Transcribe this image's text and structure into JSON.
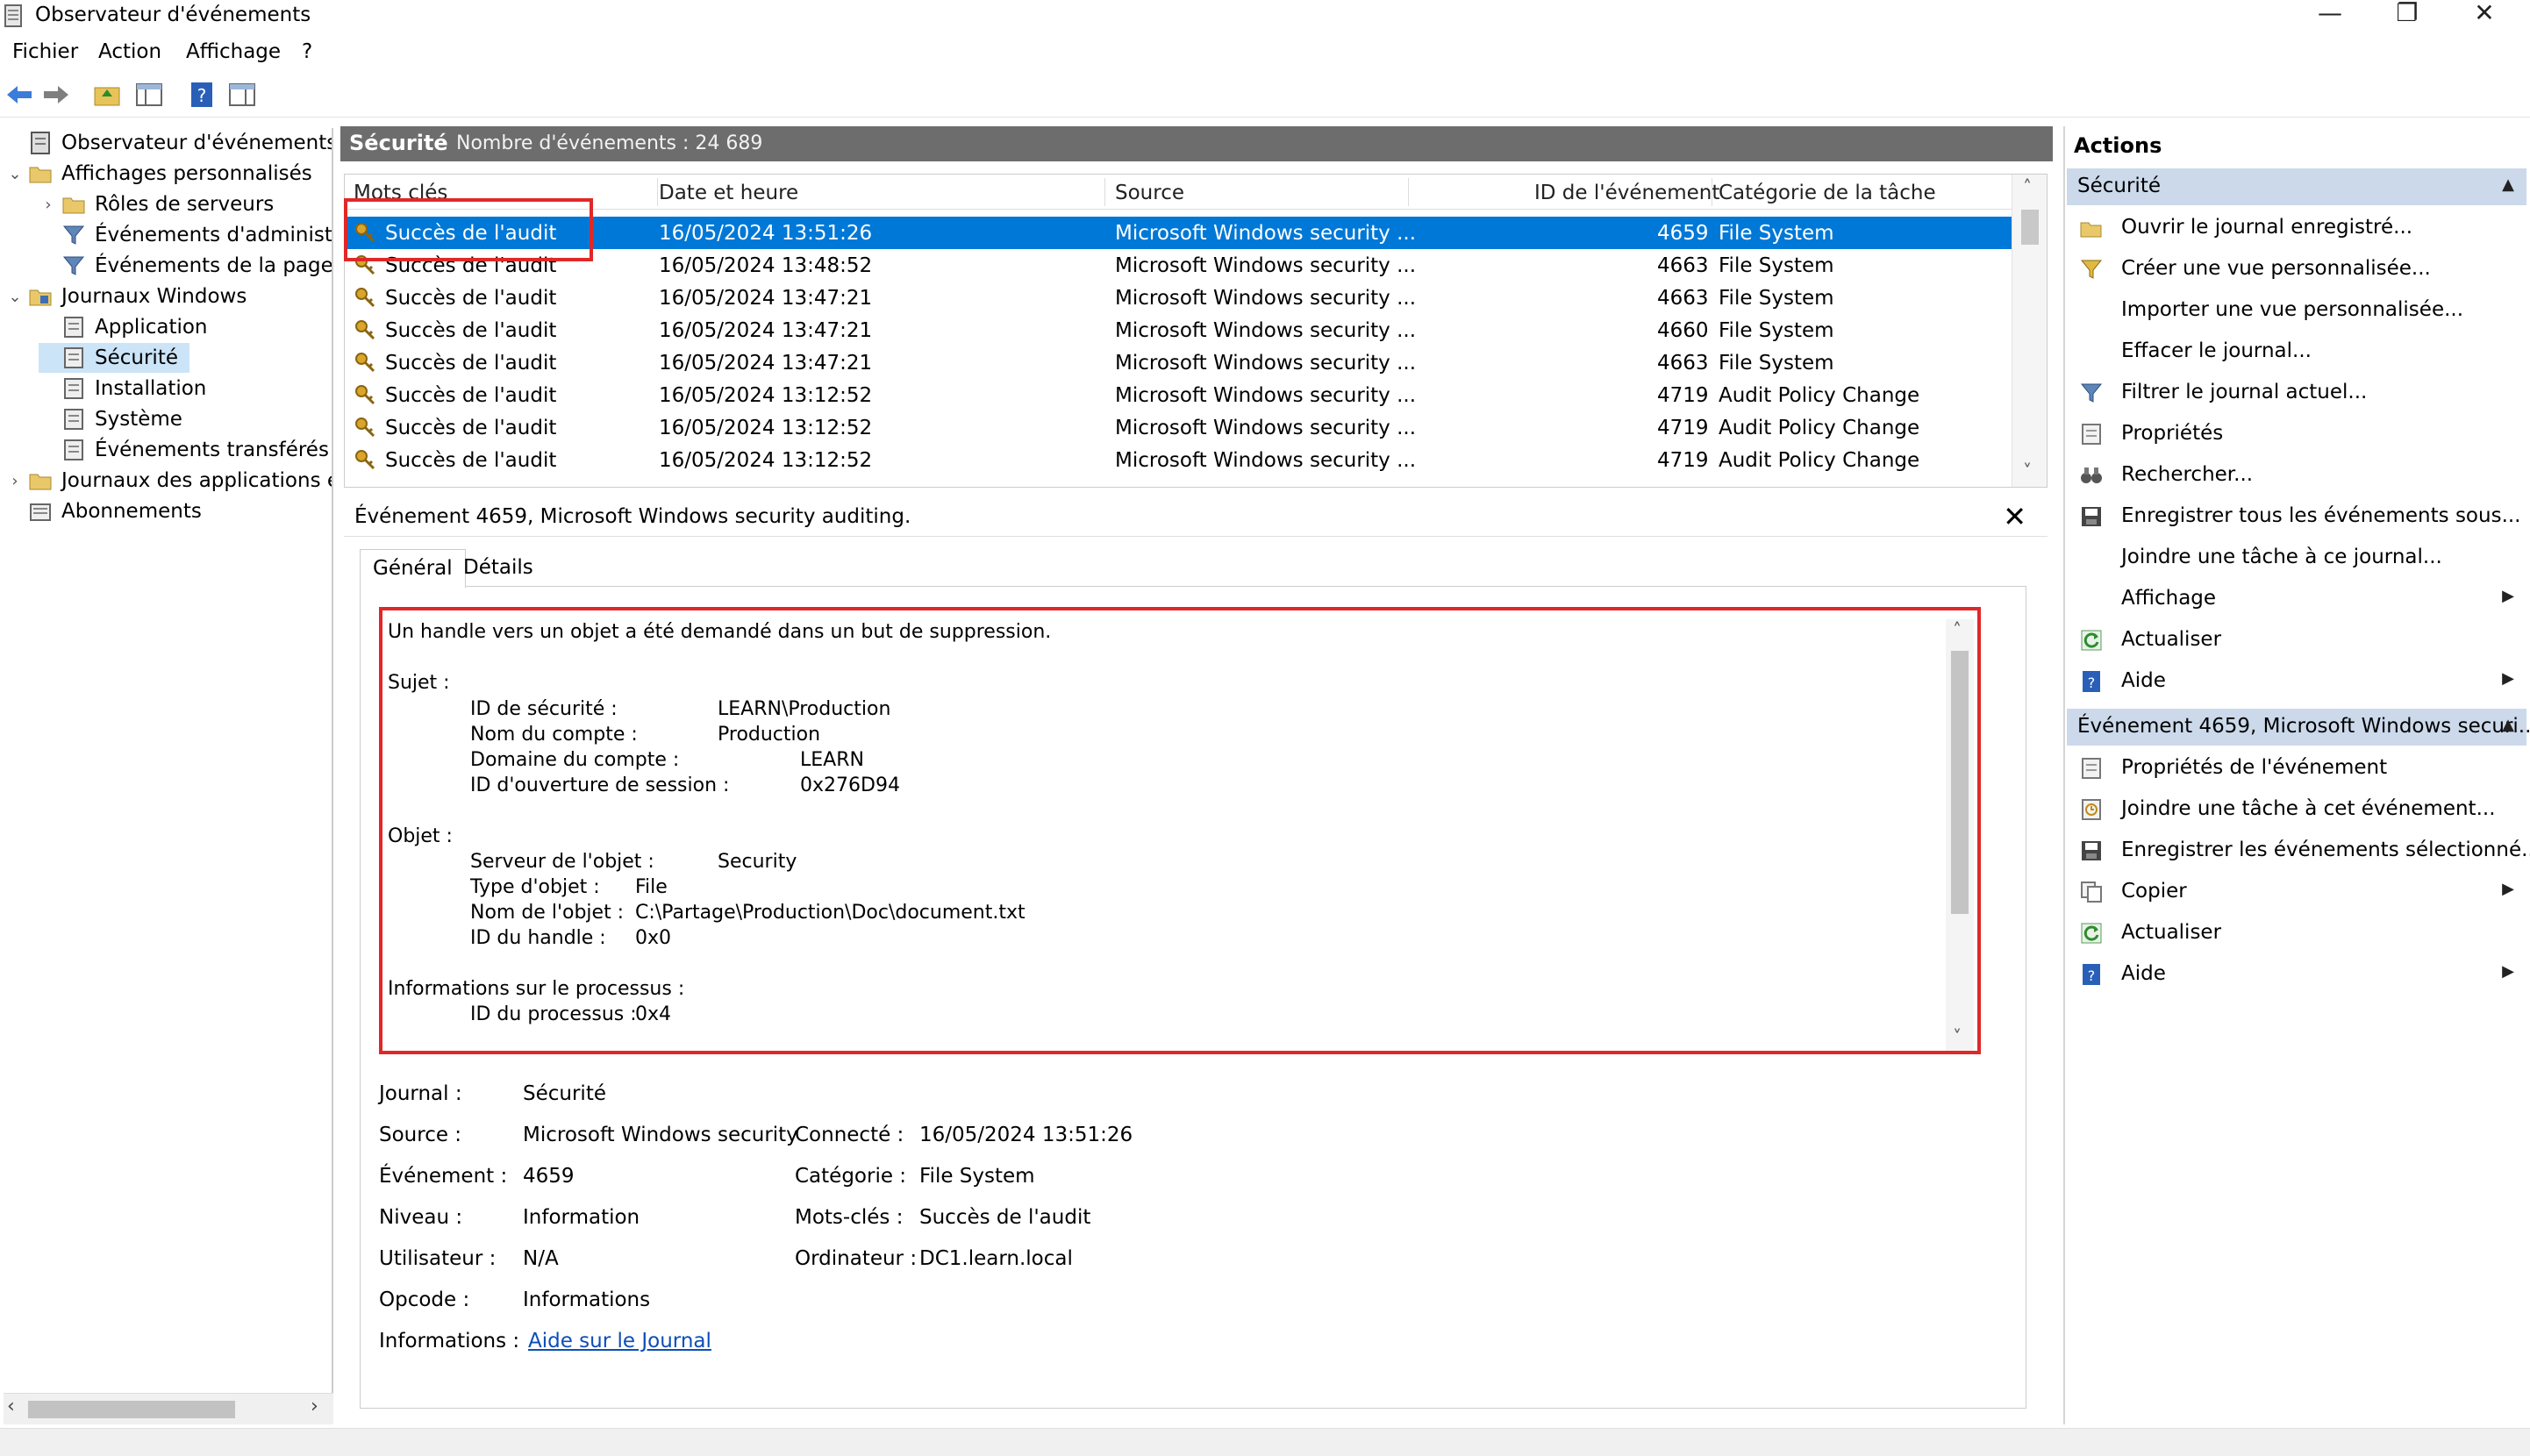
{
  "window": {
    "title": "Observateur d'événements",
    "minimize": "—",
    "restore": "❐",
    "close": "✕"
  },
  "menu": [
    "Fichier",
    "Action",
    "Affichage",
    "?"
  ],
  "tree": {
    "items": [
      {
        "label": "Observateur d'événements (Loc",
        "twisty": "",
        "level": 0
      },
      {
        "label": "Affichages personnalisés",
        "twisty": "⌄",
        "level": 0
      },
      {
        "label": "Rôles de serveurs",
        "twisty": "›",
        "level": 1
      },
      {
        "label": "Événements d'administra",
        "twisty": "",
        "level": 1
      },
      {
        "label": "Événements de la page d",
        "twisty": "",
        "level": 1
      },
      {
        "label": "Journaux Windows",
        "twisty": "⌄",
        "level": 0
      },
      {
        "label": "Application",
        "twisty": "",
        "level": 1
      },
      {
        "label": "Sécurité",
        "twisty": "",
        "level": 1
      },
      {
        "label": "Installation",
        "twisty": "",
        "level": 1
      },
      {
        "label": "Système",
        "twisty": "",
        "level": 1
      },
      {
        "label": "Événements transférés",
        "twisty": "",
        "level": 1
      },
      {
        "label": "Journaux des applications et",
        "twisty": "›",
        "level": 0
      },
      {
        "label": "Abonnements",
        "twisty": "",
        "level": 0
      }
    ]
  },
  "center": {
    "log_name": "Sécurité",
    "event_count": "Nombre d'événements : 24 689",
    "columns": [
      "Mots clés",
      "Date et heure",
      "Source",
      "ID de l'événement",
      "Catégorie de la tâche"
    ],
    "rows": [
      {
        "keyword": "Succès de l'audit",
        "date": "16/05/2024 13:51:26",
        "source": "Microsoft Windows security ...",
        "id": "4659",
        "category": "File System"
      },
      {
        "keyword": "Succès de l'audit",
        "date": "16/05/2024 13:48:52",
        "source": "Microsoft Windows security ...",
        "id": "4663",
        "category": "File System"
      },
      {
        "keyword": "Succès de l'audit",
        "date": "16/05/2024 13:47:21",
        "source": "Microsoft Windows security ...",
        "id": "4663",
        "category": "File System"
      },
      {
        "keyword": "Succès de l'audit",
        "date": "16/05/2024 13:47:21",
        "source": "Microsoft Windows security ...",
        "id": "4660",
        "category": "File System"
      },
      {
        "keyword": "Succès de l'audit",
        "date": "16/05/2024 13:47:21",
        "source": "Microsoft Windows security ...",
        "id": "4663",
        "category": "File System"
      },
      {
        "keyword": "Succès de l'audit",
        "date": "16/05/2024 13:12:52",
        "source": "Microsoft Windows security ...",
        "id": "4719",
        "category": "Audit Policy Change"
      },
      {
        "keyword": "Succès de l'audit",
        "date": "16/05/2024 13:12:52",
        "source": "Microsoft Windows security ...",
        "id": "4719",
        "category": "Audit Policy Change"
      },
      {
        "keyword": "Succès de l'audit",
        "date": "16/05/2024 13:12:52",
        "source": "Microsoft Windows security ...",
        "id": "4719",
        "category": "Audit Policy Change"
      }
    ]
  },
  "detail": {
    "title": "Événement 4659, Microsoft Windows security auditing.",
    "close": "✕",
    "tabs": [
      "Général",
      "Détails"
    ],
    "description": {
      "intro": "Un handle vers un objet a été demandé dans un but de suppression.",
      "subject_label": "Sujet :",
      "subject": [
        {
          "k": "ID de sécurité :",
          "v": "LEARN\\Production"
        },
        {
          "k": "Nom du compte :",
          "v": "Production"
        },
        {
          "k": "Domaine du compte :",
          "v": "LEARN"
        },
        {
          "k": "ID d'ouverture de session :",
          "v": "0x276D94"
        }
      ],
      "object_label": "Objet :",
      "object": [
        {
          "k": "Serveur de l'objet :",
          "v": "Security"
        },
        {
          "k": "Type d'objet :",
          "v": "File"
        },
        {
          "k": "Nom de l'objet :",
          "v": "C:\\Partage\\Production\\Doc\\document.txt"
        },
        {
          "k": "ID du handle :",
          "v": "0x0"
        }
      ],
      "process_label": "Informations sur le processus :",
      "process": [
        {
          "k": "ID du processus :",
          "v": "0x4"
        }
      ]
    },
    "props": {
      "journal_k": "Journal :",
      "journal_v": "Sécurité",
      "source_k": "Source :",
      "source_v": "Microsoft Windows security",
      "connecte_k": "Connecté :",
      "connecte_v": "16/05/2024 13:51:26",
      "evenement_k": "Événement :",
      "evenement_v": "4659",
      "categorie_k": "Catégorie :",
      "categorie_v": "File System",
      "niveau_k": "Niveau :",
      "niveau_v": "Information",
      "motscles_k": "Mots-clés :",
      "motscles_v": "Succès de l'audit",
      "utilisateur_k": "Utilisateur :",
      "utilisateur_v": "N/A",
      "ordinateur_k": "Ordinateur :",
      "ordinateur_v": "DC1.learn.local",
      "opcode_k": "Opcode :",
      "opcode_v": "Informations",
      "informations_k": "Informations :",
      "informations_v": "Aide sur le Journal"
    }
  },
  "actions": {
    "title": "Actions",
    "section1": "Sécurité",
    "section1_items": [
      {
        "label": "Ouvrir le journal enregistré...",
        "icon": "open-folder-icon",
        "sub": ""
      },
      {
        "label": "Créer une vue personnalisée...",
        "icon": "filter-icon",
        "sub": ""
      },
      {
        "label": "Importer une vue personnalisée...",
        "icon": "",
        "sub": ""
      },
      {
        "label": "Effacer le journal...",
        "icon": "",
        "sub": ""
      },
      {
        "label": "Filtrer le journal actuel...",
        "icon": "filter-icon",
        "sub": ""
      },
      {
        "label": "Propriétés",
        "icon": "properties-icon",
        "sub": ""
      },
      {
        "label": "Rechercher...",
        "icon": "binoculars-icon",
        "sub": ""
      },
      {
        "label": "Enregistrer tous les événements sous...",
        "icon": "save-icon",
        "sub": ""
      },
      {
        "label": "Joindre une tâche à ce journal...",
        "icon": "",
        "sub": ""
      },
      {
        "label": "Affichage",
        "icon": "",
        "sub": "▶"
      },
      {
        "label": "Actualiser",
        "icon": "refresh-icon",
        "sub": ""
      },
      {
        "label": "Aide",
        "icon": "help-icon",
        "sub": "▶"
      }
    ],
    "section2": "Événement 4659, Microsoft Windows securi...",
    "section2_items": [
      {
        "label": "Propriétés de l'événement",
        "icon": "properties-icon",
        "sub": ""
      },
      {
        "label": "Joindre une tâche à cet événement...",
        "icon": "task-icon",
        "sub": ""
      },
      {
        "label": "Enregistrer les événements sélectionné...",
        "icon": "save-icon",
        "sub": ""
      },
      {
        "label": "Copier",
        "icon": "copy-icon",
        "sub": "▶"
      },
      {
        "label": "Actualiser",
        "icon": "refresh-icon",
        "sub": ""
      },
      {
        "label": "Aide",
        "icon": "help-icon",
        "sub": "▶"
      }
    ]
  },
  "colors": {
    "selection": "#0078d7",
    "section_header": "#cbd9ea",
    "highlight": "#e02828",
    "center_header": "#6d6d6d"
  }
}
